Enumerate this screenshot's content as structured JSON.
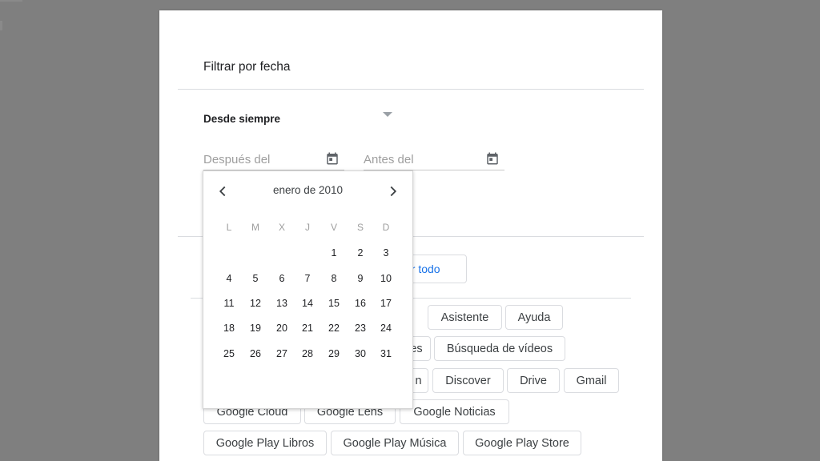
{
  "dialog": {
    "title": "Filtrar por fecha",
    "range_select": {
      "value": "Desde siempre"
    },
    "after_field": {
      "placeholder": "Después del",
      "value": ""
    },
    "before_field": {
      "placeholder": "Antes del",
      "value": ""
    },
    "reset_button": {
      "label": "ar todo"
    }
  },
  "chips": {
    "row1": [
      "Asistente",
      "Ayuda"
    ],
    "row2": [
      "es",
      "Búsqueda de vídeos"
    ],
    "row3": [
      "n",
      "Discover",
      "Drive",
      "Gmail"
    ],
    "row4": [
      "Google Cloud",
      "Google Lens",
      "Google Noticias"
    ],
    "row5": [
      "Google Play Libros",
      "Google Play Música",
      "Google Play Store"
    ]
  },
  "datepicker": {
    "month_label": "enero de 2010",
    "prev_icon": "chevron-left-icon",
    "next_icon": "chevron-right-icon",
    "weekdays": [
      "L",
      "M",
      "X",
      "J",
      "V",
      "S",
      "D"
    ],
    "weeks": [
      [
        "",
        "",
        "",
        "",
        "1",
        "2",
        "3"
      ],
      [
        "4",
        "5",
        "6",
        "7",
        "8",
        "9",
        "10"
      ],
      [
        "11",
        "12",
        "13",
        "14",
        "15",
        "16",
        "17"
      ],
      [
        "18",
        "19",
        "20",
        "21",
        "22",
        "23",
        "24"
      ],
      [
        "25",
        "26",
        "27",
        "28",
        "29",
        "30",
        "31"
      ]
    ]
  },
  "colors": {
    "overlay": "#7f7f7f",
    "accent": "#1a73e8",
    "divider": "#dadce0",
    "text": "#202124",
    "muted": "#9e9e9e"
  }
}
